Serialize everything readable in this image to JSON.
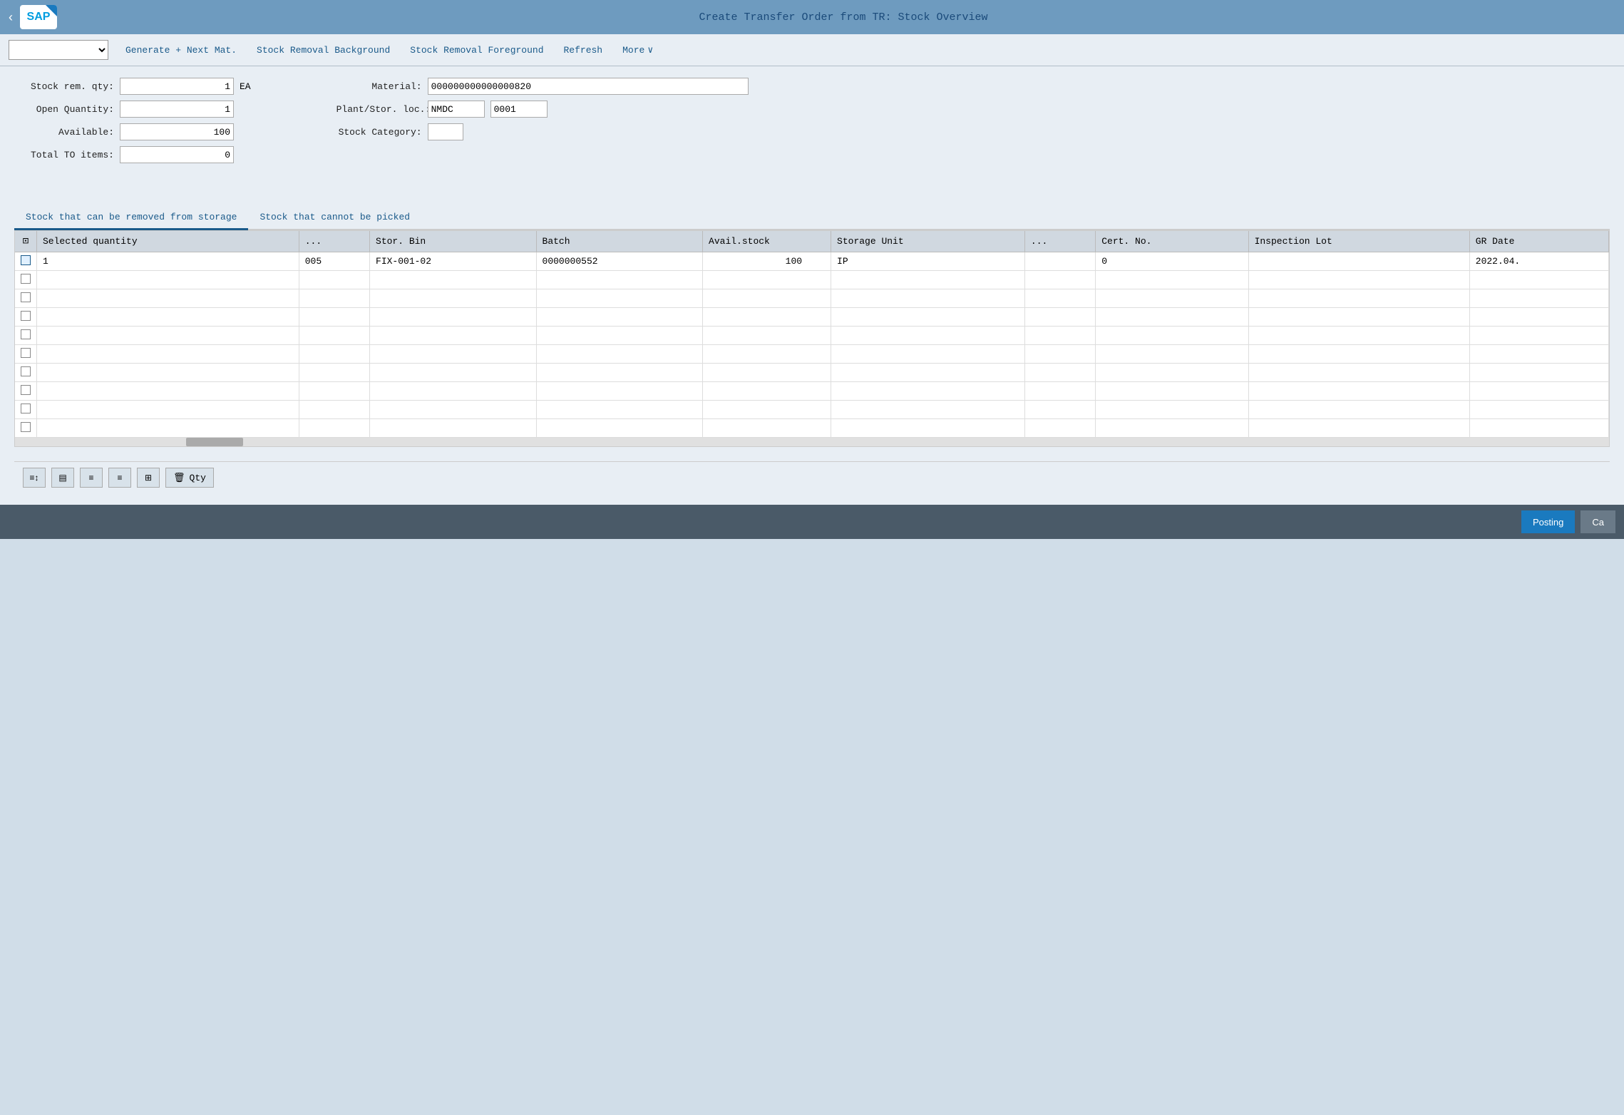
{
  "header": {
    "title": "Create Transfer Order from TR: Stock Overview",
    "back_label": "‹"
  },
  "toolbar": {
    "select_placeholder": "",
    "generate_next_btn": "Generate + Next Mat.",
    "stock_removal_bg_btn": "Stock Removal Background",
    "stock_removal_fg_btn": "Stock Removal Foreground",
    "refresh_btn": "Refresh",
    "more_btn": "More",
    "chevron": "∨"
  },
  "form": {
    "stock_rem_qty_label": "Stock rem. qty:",
    "stock_rem_qty_value": "1",
    "stock_rem_unit": "EA",
    "open_quantity_label": "Open Quantity:",
    "open_quantity_value": "1",
    "available_label": "Available:",
    "available_value": "100",
    "total_to_label": "Total TO items:",
    "total_to_value": "0",
    "material_label": "Material:",
    "material_value": "000000000000000820",
    "plant_stor_label": "Plant/Stor. loc.:",
    "plant_value": "NMDC",
    "stor_loc_value": "0001",
    "stock_category_label": "Stock Category:",
    "stock_category_value": ""
  },
  "tabs": [
    {
      "id": "removable",
      "label": "Stock that can be removed from storage",
      "active": true
    },
    {
      "id": "not_picked",
      "label": "Stock that cannot be picked",
      "active": false
    }
  ],
  "table": {
    "columns": [
      {
        "id": "check",
        "label": ""
      },
      {
        "id": "selected_qty",
        "label": "Selected quantity"
      },
      {
        "id": "ellipsis1",
        "label": "..."
      },
      {
        "id": "stor_bin",
        "label": "Stor. Bin"
      },
      {
        "id": "batch",
        "label": "Batch"
      },
      {
        "id": "avail_stock",
        "label": "Avail.stock"
      },
      {
        "id": "storage_unit",
        "label": "Storage Unit"
      },
      {
        "id": "ellipsis2",
        "label": "..."
      },
      {
        "id": "cert_no",
        "label": "Cert. No."
      },
      {
        "id": "inspection_lot",
        "label": "Inspection Lot"
      },
      {
        "id": "gr_date",
        "label": "GR Date"
      }
    ],
    "rows": [
      {
        "check": true,
        "selected_qty": "1",
        "ellipsis1": "005",
        "stor_bin": "FIX-001-02",
        "batch": "0000000552",
        "avail_stock": "100",
        "storage_unit": "IP",
        "ellipsis2": "",
        "cert_no": "0",
        "inspection_lot": "",
        "gr_date": "2022.04."
      }
    ],
    "empty_rows": 9
  },
  "bottom_toolbar": {
    "qty_label": "Qty",
    "trash_icon": "🗑"
  },
  "footer": {
    "posting_btn": "Posting",
    "cancel_btn": "Ca"
  }
}
